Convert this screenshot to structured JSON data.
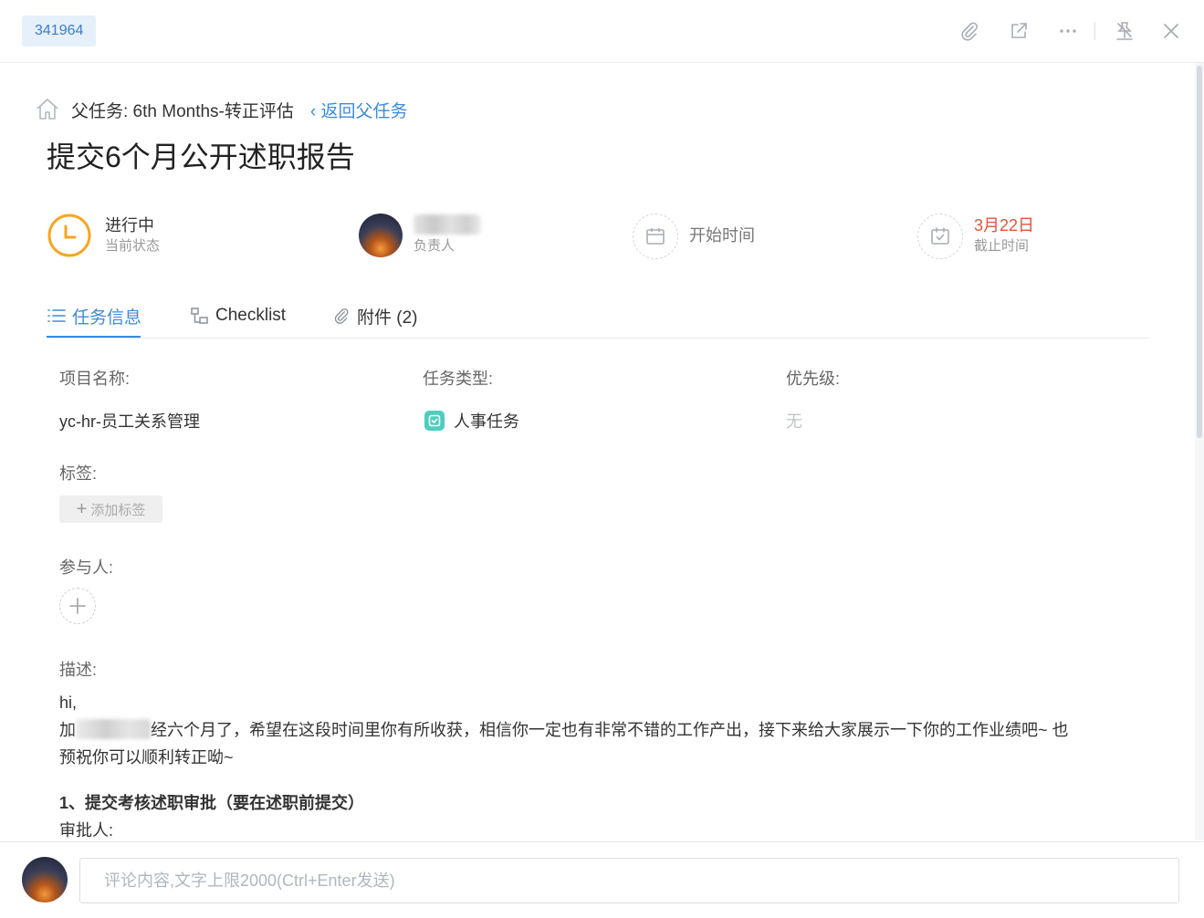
{
  "header": {
    "task_id": "341964",
    "icons": [
      "attachment-icon",
      "open-external-icon",
      "more-icon",
      "unpin-icon",
      "close-icon"
    ]
  },
  "breadcrumb": {
    "parent": "父任务: 6th Months-转正评估",
    "back": "返回父任务"
  },
  "task": {
    "title": "提交6个月公开述职报告"
  },
  "meta": {
    "status_value": "进行中",
    "status_label": "当前状态",
    "status_color": "#f5a623",
    "owner_label": "负责人",
    "start_label": "开始时间",
    "due_value": "3月22日",
    "due_label": "截止时间",
    "due_color": "#e5533c"
  },
  "tabs": [
    {
      "label": "任务信息"
    },
    {
      "label": "Checklist"
    },
    {
      "label": "附件 (2)"
    }
  ],
  "fields": {
    "project_label": "项目名称:",
    "project_value": "yc-hr-员工关系管理",
    "type_label": "任务类型:",
    "type_value": "人事任务",
    "priority_label": "优先级:",
    "priority_value": "无",
    "tags_label": "标签:",
    "add_tag": "添加标签",
    "members_label": "参与人:",
    "desc_label": "描述:"
  },
  "description": {
    "line1": "hi,",
    "line2_prefix": "加",
    "line2_suffix": "经六个月了，希望在这段时间里你有所收获，相信你一定也有非常不错的工作产出，接下来给大家展示一下你的工作业绩吧~ 也",
    "line3": "预祝你可以顺利转正呦~",
    "section1": "1、提交考核述职审批（要在述职前提交）",
    "approver": "审批人:"
  },
  "comment": {
    "placeholder": "评论内容,文字上限2000(Ctrl+Enter发送)"
  },
  "colors": {
    "accent": "#3d8bd9",
    "type_badge": "#4ecdbf"
  }
}
